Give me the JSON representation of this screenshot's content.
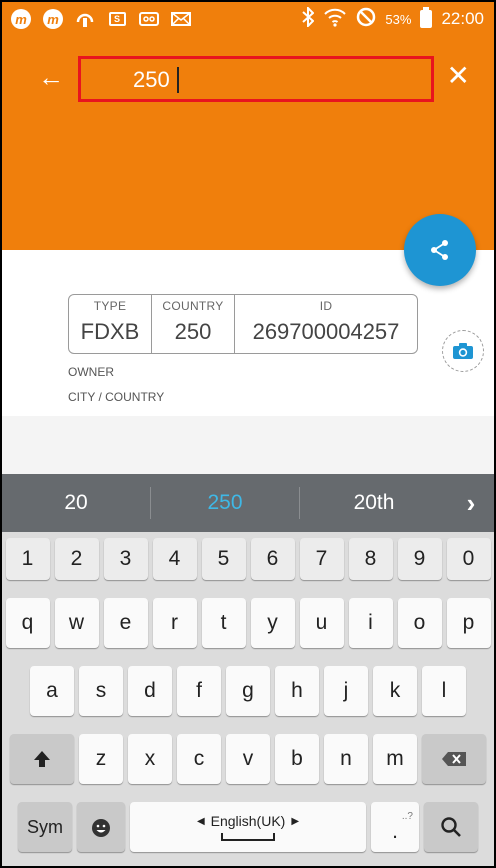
{
  "status_bar": {
    "notification_icons": [
      "m-app-icon",
      "m-app-icon",
      "download-icon",
      "image-icon",
      "voicemail-icon",
      "mail-icon"
    ],
    "battery_percent": "53%",
    "time": "22:00"
  },
  "search": {
    "value": "250"
  },
  "tag": {
    "type_label": "TYPE",
    "type_value": "FDXB",
    "country_label": "COUNTRY",
    "country_value": "250",
    "id_label": "ID",
    "id_value": "269700004257"
  },
  "owner_label": "OWNER",
  "city_country_label": "CITY / COUNTRY",
  "keyboard": {
    "suggestions": [
      "20",
      "250",
      "20th"
    ],
    "number_row": [
      "1",
      "2",
      "3",
      "4",
      "5",
      "6",
      "7",
      "8",
      "9",
      "0"
    ],
    "row1": [
      "q",
      "w",
      "e",
      "r",
      "t",
      "y",
      "u",
      "i",
      "o",
      "p"
    ],
    "row2": [
      "a",
      "s",
      "d",
      "f",
      "g",
      "h",
      "j",
      "k",
      "l"
    ],
    "row3": [
      "z",
      "x",
      "c",
      "v",
      "b",
      "n",
      "m"
    ],
    "sym_label": "Sym",
    "language_label": "English(UK)",
    "period_label": ".",
    "period_hint": "..?"
  },
  "colors": {
    "accent": "#f07f0c",
    "fab": "#1e95d3",
    "highlight_border": "#e8141e",
    "suggestion_active": "#3fb8e6"
  }
}
